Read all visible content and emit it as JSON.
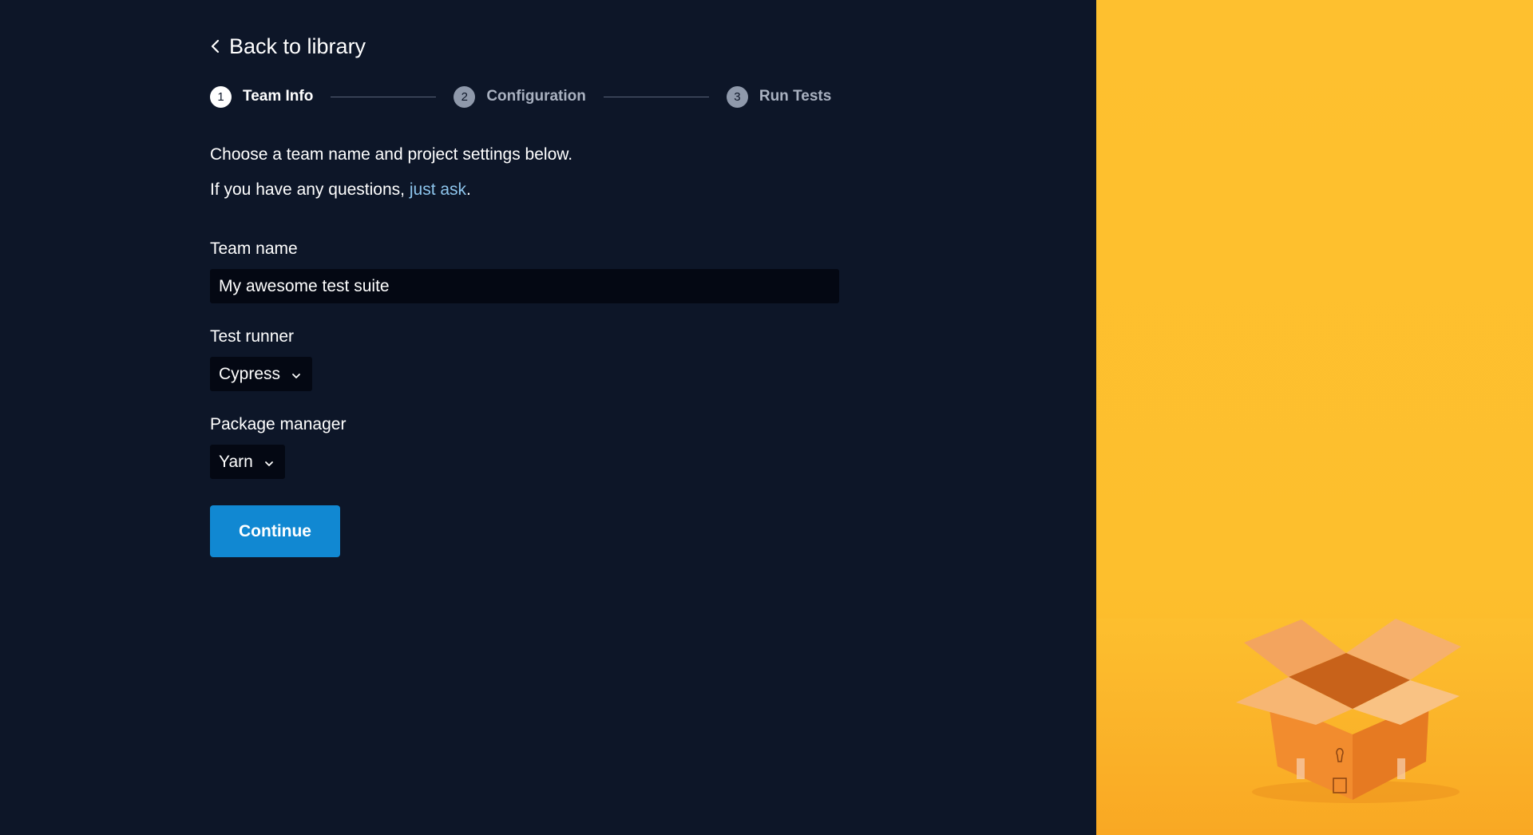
{
  "nav": {
    "back_label": "Back to library"
  },
  "stepper": {
    "steps": [
      {
        "number": "1",
        "label": "Team Info",
        "state": "active"
      },
      {
        "number": "2",
        "label": "Configuration",
        "state": "inactive"
      },
      {
        "number": "3",
        "label": "Run Tests",
        "state": "inactive"
      }
    ]
  },
  "intro": {
    "line1": "Choose a team name and project settings below.",
    "line2_prefix": "If you have any questions,",
    "line2_link": "just ask",
    "line2_suffix": "."
  },
  "form": {
    "team_name_label": "Team name",
    "team_name_value": "My awesome test suite",
    "test_runner_label": "Test runner",
    "test_runner_value": "Cypress",
    "package_manager_label": "Package manager",
    "package_manager_value": "Yarn",
    "continue_label": "Continue"
  },
  "colors": {
    "background": "#0d1628",
    "input_background": "#040813",
    "accent_button": "#1188d2",
    "link": "#8ec6ee",
    "illustration_background": "#fec02f",
    "box": "#f08a2c"
  },
  "icons": {
    "back": "chevron-left-icon",
    "dropdown": "chevron-down-icon",
    "illustration": "open-box-illustration"
  }
}
